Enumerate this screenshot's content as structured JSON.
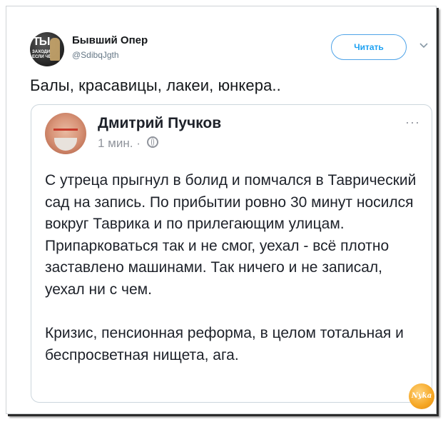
{
  "tweet": {
    "author_name": "Бывший Опер",
    "author_handle": "@SdibqJgth",
    "avatar_text_line1": "ТЫ",
    "avatar_text_line2": "ЗАХОДИ ЕСЛИ ЧЁ",
    "follow_label": "Читать",
    "text": "Балы, красавицы, лакеи, юнкера.."
  },
  "quote": {
    "author_name": "Дмитрий Пучков",
    "time": "1 мин.",
    "separator": "·",
    "more": "···",
    "paragraphs": [
      "С утреца прыгнул в болид и помчался в Таврический сад на запись. По прибытии ровно 30 минут носился вокруг Таврика и по прилегающим улицам. Припарковаться так и не смог, уехал - всё плотно заставлено машинами. Так ничего и не записал, уехал ни с чем.",
      "Кризис, пенсионная реформа, в целом тотальная и беспросветная нищета, ага."
    ]
  },
  "watermark": {
    "text": "Nyka"
  },
  "colors": {
    "link": "#1da1f2",
    "border": "#ccd6dd",
    "muted": "#657786"
  },
  "icons": [
    "caret-down-icon",
    "globe-icon",
    "more-icon"
  ]
}
